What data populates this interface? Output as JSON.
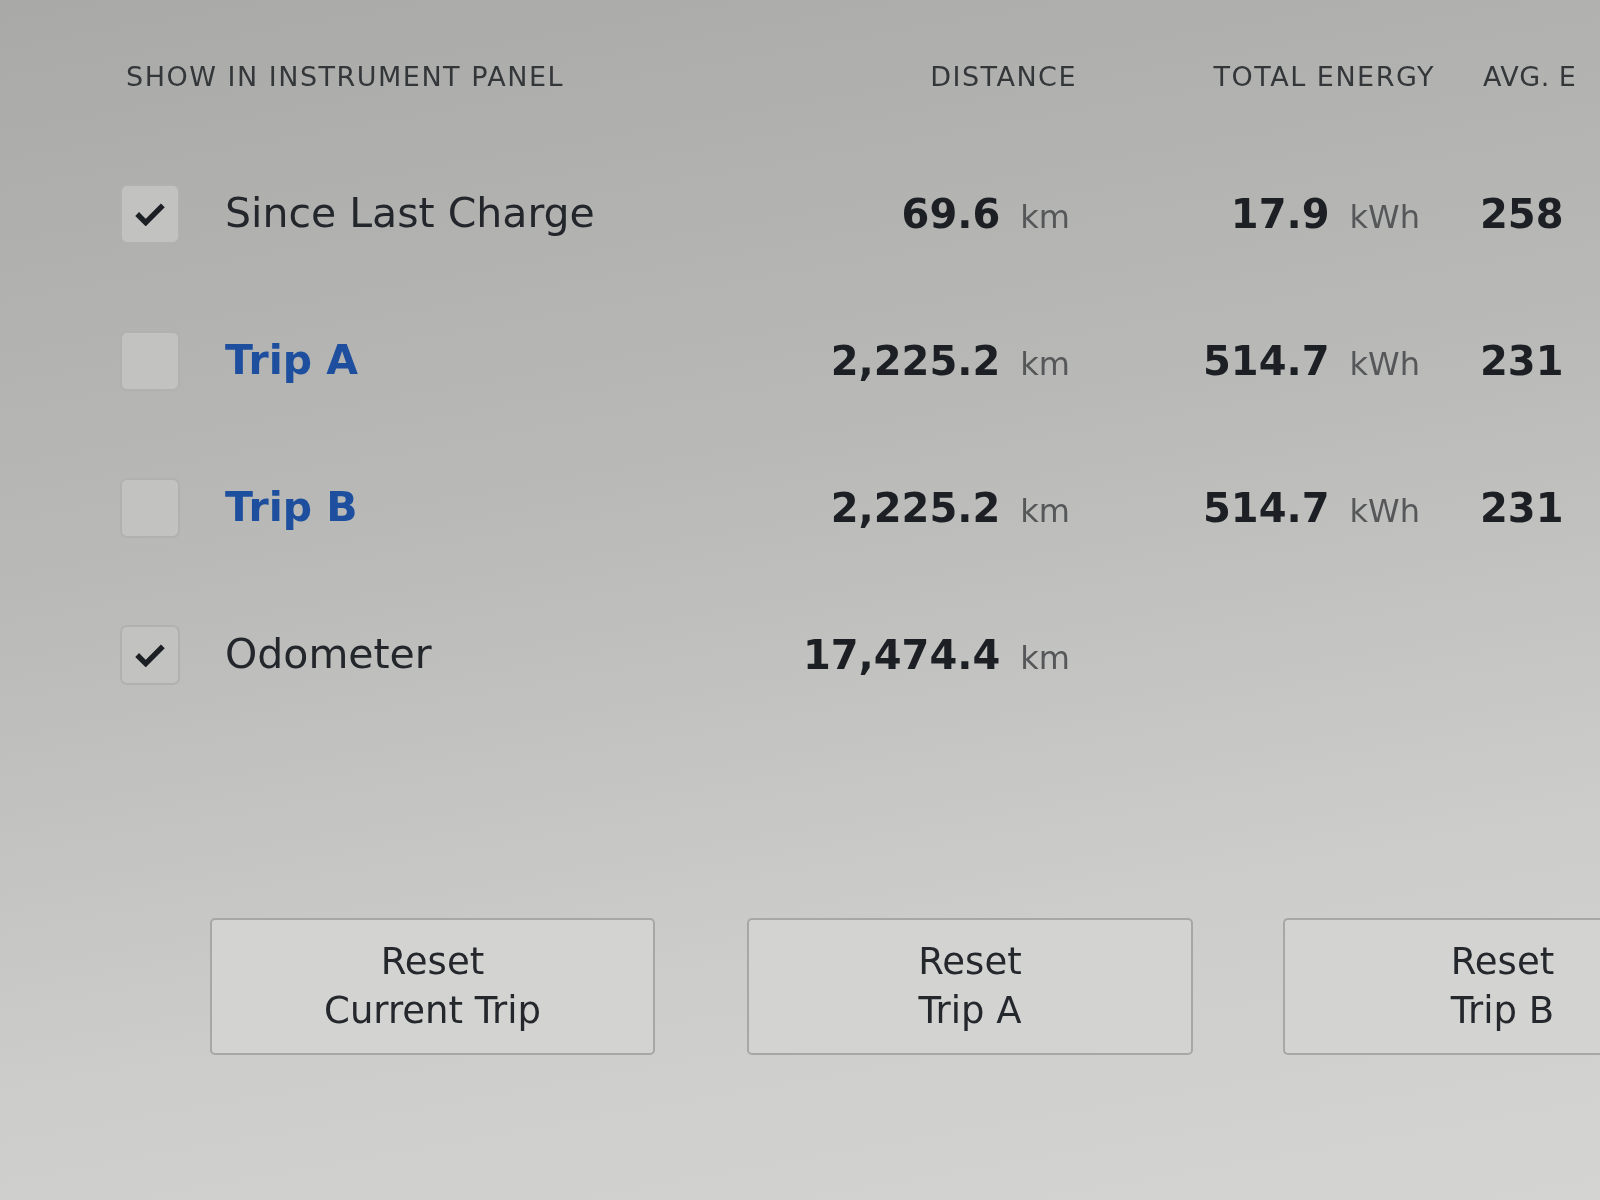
{
  "columns": [
    {
      "label": "SHOW IN INSTRUMENT PANEL"
    },
    {
      "label": "DISTANCE"
    },
    {
      "label": "TOTAL ENERGY"
    },
    {
      "label": "AVG. E"
    }
  ],
  "rows": [
    {
      "kind": "plain",
      "checked": true,
      "label": "Since Last Charge",
      "distance": {
        "value": "69.6",
        "unit": "km"
      },
      "energy": {
        "value": "17.9",
        "unit": "kWh"
      },
      "average": "258"
    },
    {
      "kind": "link",
      "checked": false,
      "label": "Trip A",
      "distance": {
        "value": "2,225.2",
        "unit": "km"
      },
      "energy": {
        "value": "514.7",
        "unit": "kWh"
      },
      "average": "231"
    },
    {
      "kind": "link",
      "checked": false,
      "label": "Trip B",
      "distance": {
        "value": "2,225.2",
        "unit": "km"
      },
      "energy": {
        "value": "514.7",
        "unit": "kWh"
      },
      "average": "231"
    },
    {
      "kind": "plain",
      "checked": true,
      "label": "Odometer",
      "distance": {
        "value": "17,474.4",
        "unit": "km"
      }
    }
  ],
  "buttons": [
    {
      "lines": [
        "Reset",
        "Current Trip"
      ]
    },
    {
      "lines": [
        "Reset",
        "Trip A"
      ]
    },
    {
      "lines": [
        "Reset",
        "Trip B"
      ]
    }
  ]
}
